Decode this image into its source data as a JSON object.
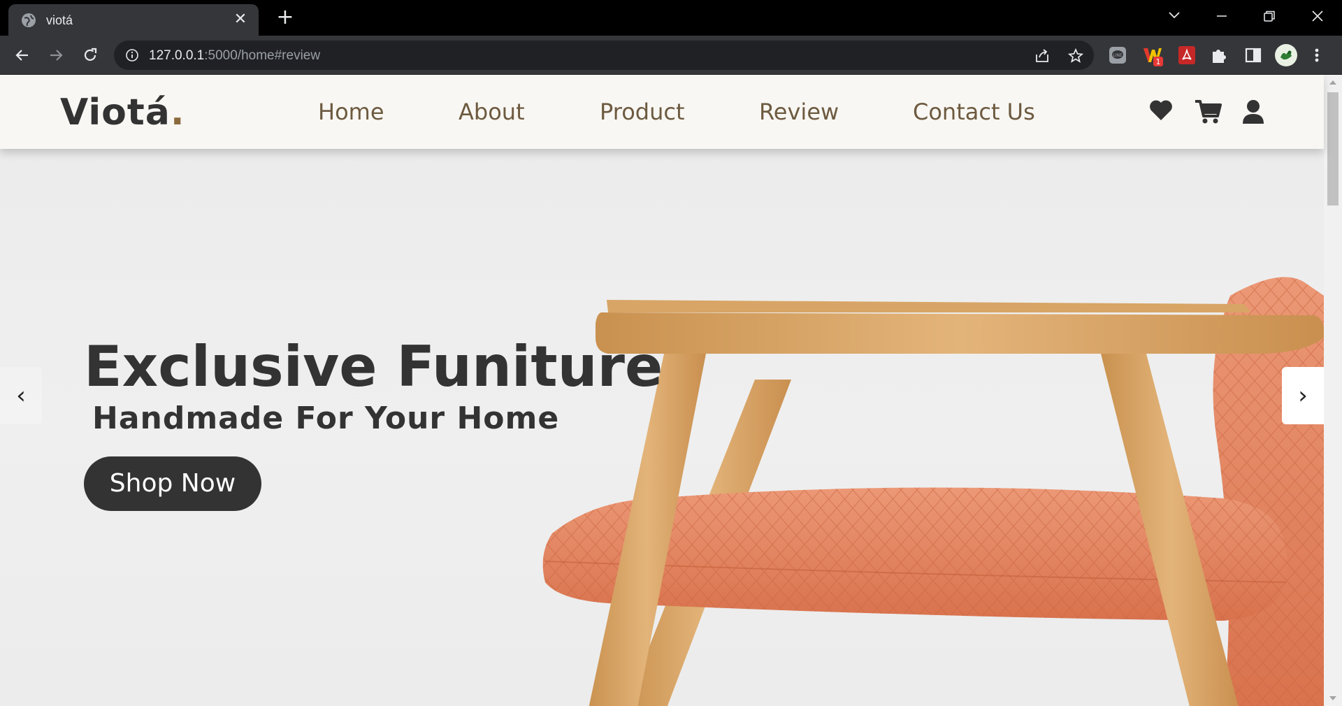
{
  "browser": {
    "tab_title": "viotá",
    "tab_close": "✕",
    "new_tab": "+",
    "url_host": "127.0.0.1",
    "url_path": ":5000/home#review",
    "extension_badge": "1"
  },
  "site": {
    "logo_text": "Viotá",
    "logo_dot": ".",
    "nav": {
      "home": "Home",
      "about": "About",
      "product": "Product",
      "review": "Review",
      "contact": "Contact Us"
    },
    "icons": [
      "heart-icon",
      "cart-icon",
      "user-icon"
    ]
  },
  "hero": {
    "title": "Exclusive Funiture",
    "subtitle": "Handmade For Your Home",
    "cta": "Shop Now",
    "prev": "‹",
    "next": "›"
  },
  "colors": {
    "text_dark": "#333333",
    "nav_brown": "#6d5a40",
    "logo_accent": "#8b6a3e",
    "header_bg": "#f8f7f3",
    "cushion": "#e08460",
    "wood": "#d9a86a"
  }
}
